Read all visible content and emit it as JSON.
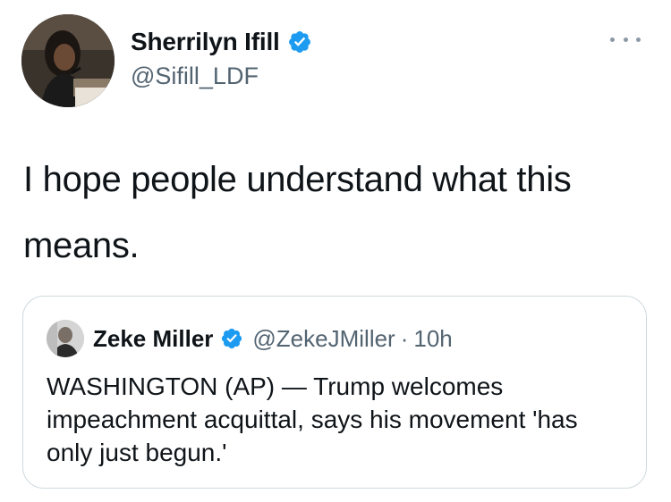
{
  "tweet": {
    "author": {
      "display_name": "Sherrilyn Ifill",
      "handle": "@Sifill_LDF",
      "verified": true
    },
    "text": "I hope people understand what this means.",
    "more_icon": "more-horizontal-icon"
  },
  "quoted_tweet": {
    "author": {
      "display_name": "Zeke Miller",
      "handle": "@ZekeJMiller",
      "verified": true
    },
    "separator": "·",
    "time": "10h",
    "text": "WASHINGTON (AP) — Trump welcomes impeachment acquittal, says his movement 'has only just begun.'"
  },
  "colors": {
    "verified_blue": "#1d9bf0",
    "secondary_text": "#536471",
    "border": "#cfd9de"
  }
}
